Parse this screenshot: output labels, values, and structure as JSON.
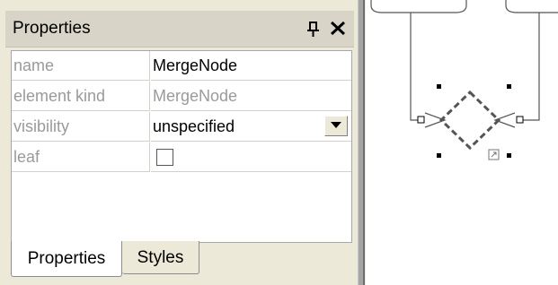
{
  "panel": {
    "title": "Properties",
    "pin_icon": "pin-icon",
    "close_icon": "close-icon"
  },
  "properties": [
    {
      "name": "name",
      "value": "MergeNode",
      "editable": true
    },
    {
      "name": "element kind",
      "value": "MergeNode",
      "editable": false
    },
    {
      "name": "visibility",
      "value": "unspecified",
      "editable": true,
      "control": "dropdown"
    },
    {
      "name": "leaf",
      "value": "",
      "editable": true,
      "control": "checkbox",
      "checked": false
    }
  ],
  "tabs": [
    {
      "label": "Properties",
      "active": true
    },
    {
      "label": "Styles",
      "active": false
    }
  ],
  "diagram": {
    "selected_element": "merge-node",
    "colors": {
      "node_stroke": "#4d4d4d",
      "edge_stroke": "#555555",
      "handle": "#000000"
    }
  }
}
